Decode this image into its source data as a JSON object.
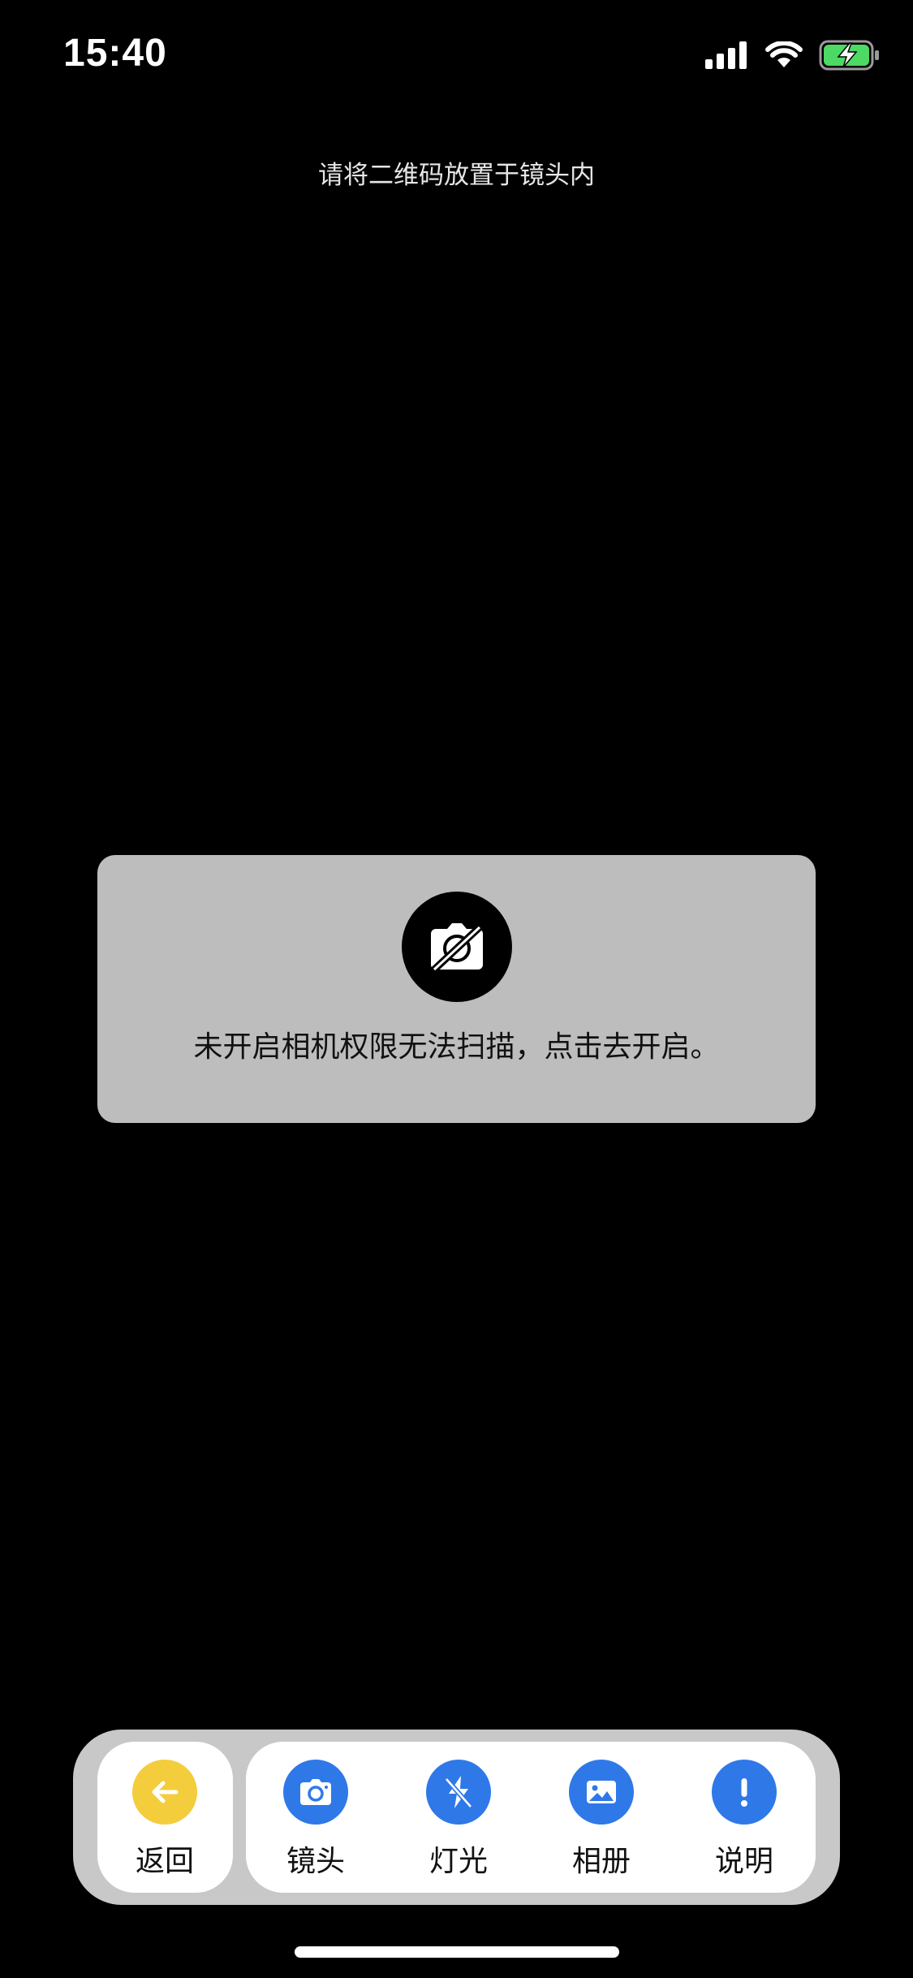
{
  "status_bar": {
    "time": "15:40"
  },
  "scanner": {
    "hint": "请将二维码放置于镜头内"
  },
  "permission": {
    "icon": "camera-off-icon",
    "message": "未开启相机权限无法扫描，点击去开启。"
  },
  "toolbar": {
    "back": {
      "label": "返回",
      "icon": "arrow-left-icon",
      "color": "#f4cd3c"
    },
    "items": [
      {
        "label": "镜头",
        "icon": "camera-icon"
      },
      {
        "label": "灯光",
        "icon": "flash-off-icon"
      },
      {
        "label": "相册",
        "icon": "image-icon"
      },
      {
        "label": "说明",
        "icon": "exclamation-icon"
      }
    ],
    "accent_color": "#2f78e8"
  },
  "colors": {
    "background": "#000000",
    "panel": "#bdbdbd",
    "toolbar_bg": "#c8c8c8",
    "battery": "#4cd964"
  }
}
